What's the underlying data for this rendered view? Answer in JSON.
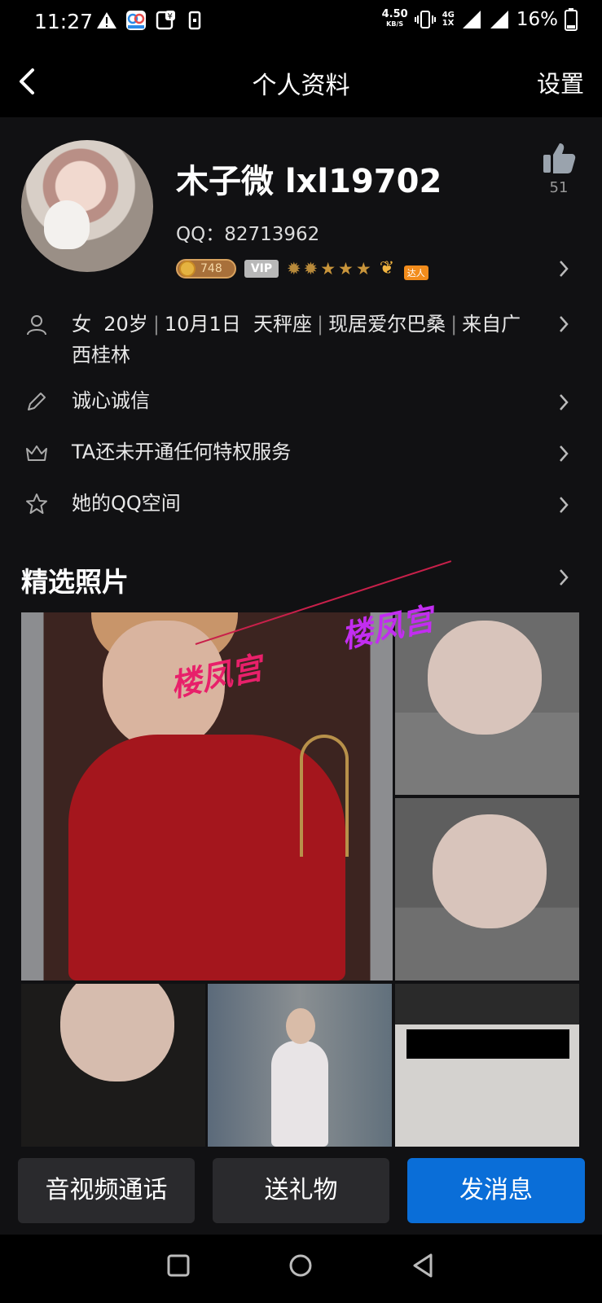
{
  "status_bar": {
    "time": "11:27",
    "net_speed": "4.50",
    "net_speed_unit": "KB/S",
    "network_type_top": "4G",
    "network_type_bottom": "1X",
    "battery": "16%"
  },
  "header": {
    "title": "个人资料",
    "settings_label": "设置"
  },
  "profile": {
    "name": "木子微 lxl19702",
    "qq": "QQ：82713962",
    "likes": "51",
    "coin_value": "748",
    "vip_label": "VIP",
    "daren_label": "达人"
  },
  "info_rows": {
    "basic": {
      "gender": "女",
      "age": "20岁",
      "birthday": "10月1日",
      "zodiac": "天秤座",
      "location": "现居爱尔巴桑",
      "hometown_part1": "来自广",
      "hometown_part2": "西桂林"
    },
    "signature": "诚心诚信",
    "privilege": "TA还未开通任何特权服务",
    "qzone": "她的QQ空间"
  },
  "photos": {
    "section_title": "精选照片",
    "watermark_1": "楼凤宫",
    "watermark_2": "楼凤宫"
  },
  "actions": {
    "call_label": "音视频通话",
    "gift_label": "送礼物",
    "message_label": "发消息"
  },
  "colors": {
    "background": "#111113",
    "primary_button": "#0a6ed8",
    "secondary_button": "#2a2a2d"
  }
}
